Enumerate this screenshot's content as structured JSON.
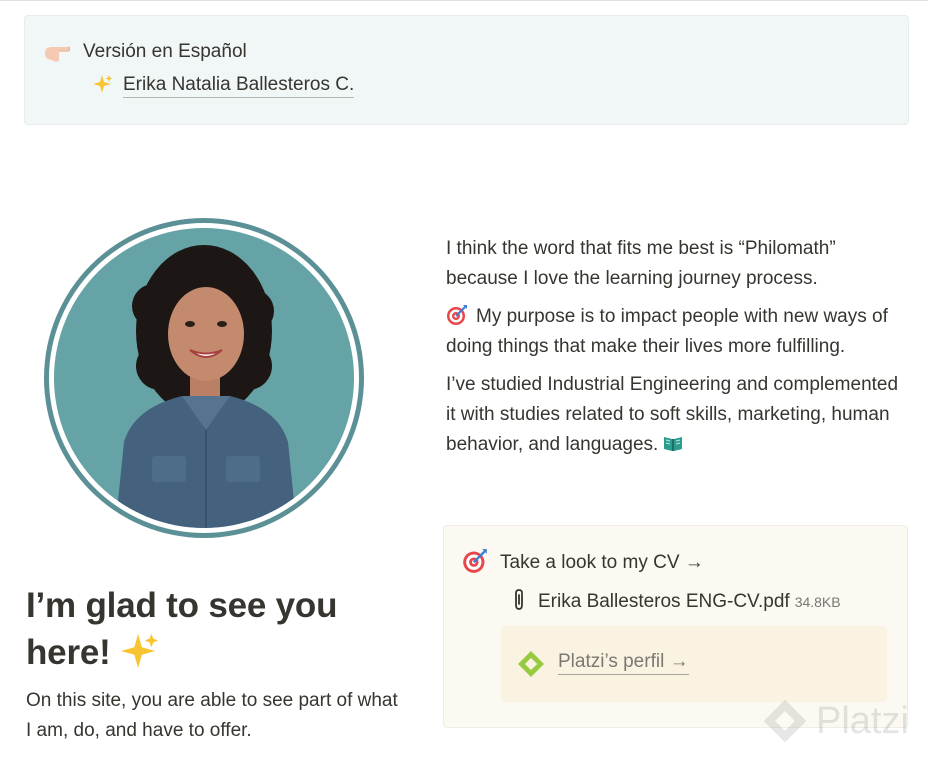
{
  "top_callout": {
    "language_label": "Versión en Español",
    "author_link": "Erika Natalia Ballesteros C."
  },
  "intro": {
    "headline": "I’m glad to see you here!",
    "subline": "On this site, you are able to see part of what I am, do, and have to offer."
  },
  "bio": {
    "p1": "I think the word that fits me best is “Philomath” because I love the learning journey process.",
    "p2": "My purpose is to impact people with new ways of doing things that make their lives more fulfilling.",
    "p3": "I’ve studied Industrial Engineering and complemented it with studies related to soft skills, marketing, human behavior, and languages."
  },
  "cv_callout": {
    "cv_link": "Take a look to my CV →",
    "file_name": "Erika Ballesteros ENG-CV.pdf",
    "file_size": "34.8KB",
    "platzi_link": "Platzi’s perfil →"
  },
  "watermark": {
    "text": "Platzi"
  },
  "icons": {
    "language": "pointing-hand-icon",
    "author": "sparkles-icon",
    "purpose": "target-icon",
    "languages": "book-icon",
    "cv": "target-icon",
    "file": "paperclip-icon",
    "platzi": "platzi-logo-icon"
  },
  "colors": {
    "accent_teal": "#5b9196",
    "photo_bg": "#66a3a6",
    "callout_blue": "#f1f6f7",
    "callout_yellow": "#fbf9f1",
    "platzi_green": "#98ca3f"
  }
}
